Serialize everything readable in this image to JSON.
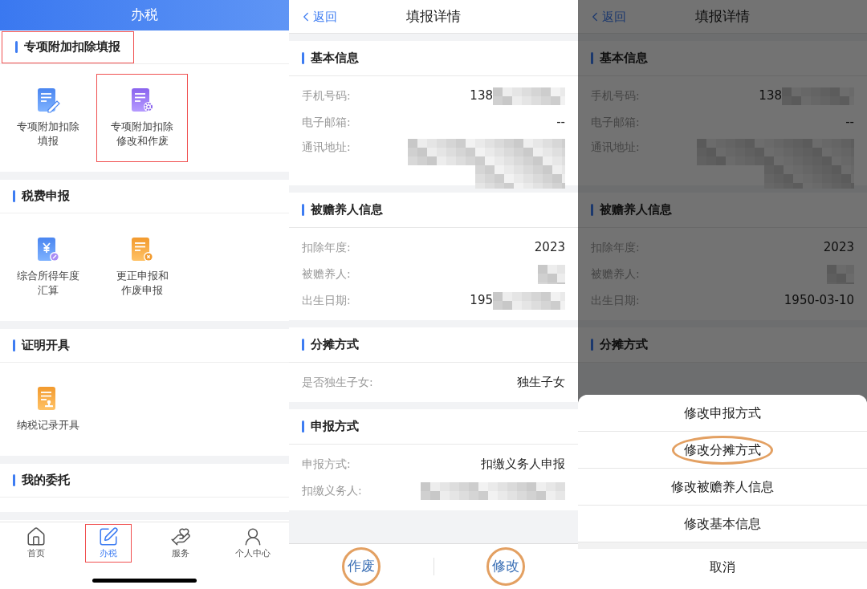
{
  "screens": [
    {
      "kind": "service-menu",
      "title": "办税",
      "sections": [
        {
          "heading": "专项附加扣除填报",
          "highlighted": true,
          "items": [
            {
              "kind": "pen",
              "lines": [
                "专项附加扣除",
                "填报"
              ],
              "highlighted": false
            },
            {
              "kind": "gear",
              "lines": [
                "专项附加扣除",
                "修改和作废"
              ],
              "highlighted": true
            }
          ]
        },
        {
          "heading": "税费申报",
          "highlighted": false,
          "items": [
            {
              "kind": "yen",
              "lines": [
                "综合所得年度",
                "汇算"
              ],
              "highlighted": false
            },
            {
              "kind": "cross",
              "lines": [
                "更正申报和",
                "作废申报"
              ],
              "highlighted": false
            }
          ]
        },
        {
          "heading": "证明开具",
          "highlighted": false,
          "items": [
            {
              "kind": "stamp",
              "lines": [
                "纳税记录开具"
              ],
              "highlighted": false
            }
          ]
        },
        {
          "heading": "我的委托",
          "highlighted": false
        }
      ],
      "tabs": [
        {
          "label": "首页",
          "kind": "home",
          "selected": false,
          "highlighted": false
        },
        {
          "label": "办税",
          "kind": "pen",
          "selected": true,
          "highlighted": true
        },
        {
          "label": "服务",
          "kind": "heart",
          "selected": false,
          "highlighted": false
        },
        {
          "label": "个人中心",
          "kind": "user",
          "selected": false,
          "highlighted": false
        }
      ]
    },
    {
      "kind": "detail",
      "back": "返回",
      "title": "填报详情",
      "sections": [
        {
          "heading": "基本信息",
          "rows": [
            {
              "label": "手机号码:",
              "value": "138",
              "kind": "partial"
            },
            {
              "label": "电子邮箱:",
              "value": "--",
              "kind": "text"
            },
            {
              "label": "通讯地址:",
              "kind": "address"
            }
          ]
        },
        {
          "heading": "被赡养人信息",
          "rows": [
            {
              "label": "扣除年度:",
              "value": "2023",
              "kind": "text"
            },
            {
              "label": "被赡养人:",
              "kind": "name"
            },
            {
              "label": "出生日期:",
              "value": "195",
              "kind": "partial"
            }
          ]
        },
        {
          "heading": "分摊方式",
          "rows": [
            {
              "label": "是否独生子女:",
              "value": "独生子女",
              "kind": "text"
            }
          ]
        },
        {
          "heading": "申报方式",
          "rows": [
            {
              "label": "申报方式:",
              "value": "扣缴义务人申报",
              "kind": "text"
            },
            {
              "label": "扣缴义务人:",
              "kind": "payer"
            }
          ]
        }
      ],
      "footer_buttons": [
        {
          "label": "作废",
          "highlighted": true
        },
        {
          "label": "修改",
          "highlighted": true
        }
      ]
    },
    {
      "kind": "detail",
      "back": "返回",
      "title": "填报详情",
      "sections": [
        {
          "heading": "基本信息",
          "rows": [
            {
              "label": "手机号码:",
              "value": "138",
              "kind": "partial"
            },
            {
              "label": "电子邮箱:",
              "value": "--",
              "kind": "text"
            },
            {
              "label": "通讯地址:",
              "kind": "address"
            }
          ]
        },
        {
          "heading": "被赡养人信息",
          "rows": [
            {
              "label": "扣除年度:",
              "value": "2023",
              "kind": "text"
            },
            {
              "label": "被赡养人:",
              "kind": "name"
            },
            {
              "label": "出生日期:",
              "value": "1950-03-10",
              "kind": "text"
            }
          ]
        },
        {
          "heading": "分摊方式"
        }
      ],
      "action_sheet": {
        "items": [
          {
            "label": "修改申报方式",
            "highlighted": false
          },
          {
            "label": "修改分摊方式",
            "highlighted": true
          },
          {
            "label": "修改被赡养人信息",
            "highlighted": false
          },
          {
            "label": "修改基本信息",
            "highlighted": false
          }
        ],
        "cancel": "取消"
      }
    }
  ]
}
